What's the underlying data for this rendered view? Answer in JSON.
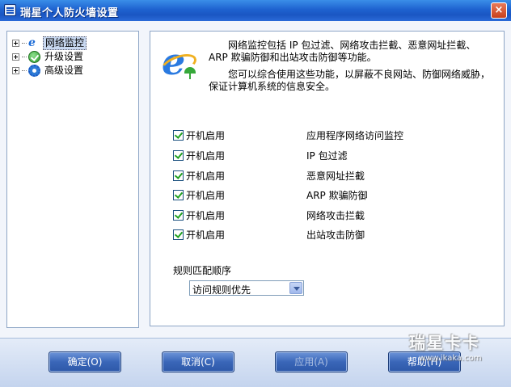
{
  "window": {
    "title": "瑞星个人防火墙设置",
    "close_glyph": "×"
  },
  "tree": {
    "items": [
      {
        "label": "网络监控",
        "icon": "ie-icon",
        "selected": true
      },
      {
        "label": "升级设置",
        "icon": "update-icon",
        "selected": false
      },
      {
        "label": "高级设置",
        "icon": "gear-icon",
        "selected": false
      }
    ]
  },
  "content": {
    "icon": "internet-explorer-icon",
    "description1": "网络监控包括 IP 包过滤、网络攻击拦截、恶意网址拦截、ARP 欺骗防御和出站攻击防御等功能。",
    "description2": "您可以综合使用这些功能，以屏蔽不良网站、防御网络威胁，保证计算机系统的信息安全。",
    "features": [
      {
        "checkbox_label": "开机启用",
        "checked": true,
        "name": "应用程序网络访问监控"
      },
      {
        "checkbox_label": "开机启用",
        "checked": true,
        "name": "IP 包过滤"
      },
      {
        "checkbox_label": "开机启用",
        "checked": true,
        "name": "恶意网址拦截"
      },
      {
        "checkbox_label": "开机启用",
        "checked": true,
        "name": "ARP 欺骗防御"
      },
      {
        "checkbox_label": "开机启用",
        "checked": true,
        "name": "网络攻击拦截"
      },
      {
        "checkbox_label": "开机启用",
        "checked": true,
        "name": "出站攻击防御"
      }
    ],
    "rule_order_label": "规则匹配顺序",
    "rule_order_value": "访问规则优先"
  },
  "buttons": {
    "ok": "确定(O)",
    "cancel": "取消(C)",
    "apply": "应用(A)",
    "help": "帮助(H)"
  },
  "watermark": {
    "main": "瑞星卡卡",
    "url": "www.ikaka.com"
  }
}
